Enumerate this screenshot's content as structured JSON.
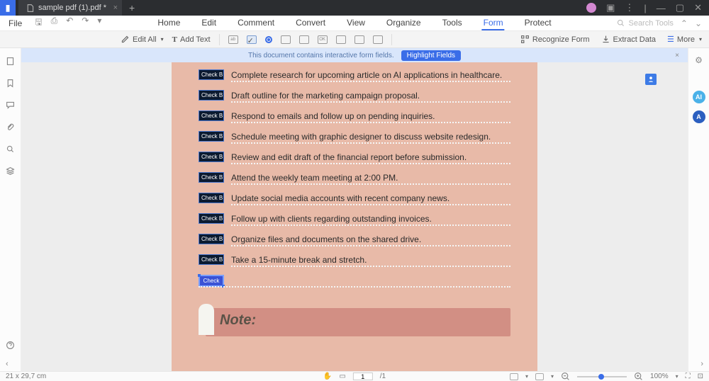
{
  "titlebar": {
    "tab_title": "sample pdf (1).pdf *"
  },
  "menu": {
    "file": "File",
    "tabs": [
      "Home",
      "Edit",
      "Comment",
      "Convert",
      "View",
      "Organize",
      "Tools",
      "Form",
      "Protect"
    ],
    "active_tab": "Form",
    "search_placeholder": "Search Tools"
  },
  "toolbar": {
    "edit_all": "Edit All",
    "add_text": "Add Text",
    "recognize": "Recognize Form",
    "extract": "Extract Data",
    "more": "More"
  },
  "banner": {
    "msg": "This document contains interactive form fields.",
    "button": "Highlight Fields"
  },
  "checkbox_label": "Check B",
  "checkbox_sel": "Check",
  "tasks": [
    "Complete research for upcoming article on AI applications in healthcare.",
    "Draft outline for the marketing campaign proposal.",
    "Respond to emails and follow up on pending inquiries.",
    "Schedule meeting with graphic designer to discuss website redesign.",
    "Review and edit draft of the financial report before submission.",
    "Attend the weekly team meeting at 2:00 PM.",
    "Update social media accounts with recent company news.",
    "Follow up with clients regarding outstanding invoices.",
    "Organize files and documents on the shared drive.",
    "Take a 15-minute break and stretch."
  ],
  "note_title": "Note:",
  "status": {
    "dimensions": "21 x 29,7 cm",
    "page": "1",
    "total": "/1",
    "zoom": "100%"
  }
}
